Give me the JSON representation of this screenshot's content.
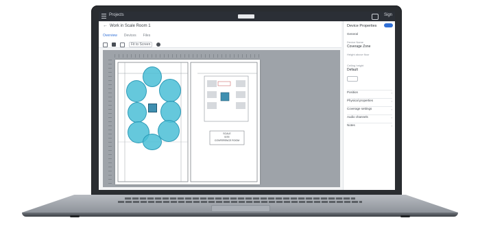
{
  "app": {
    "title": "Projects",
    "account_label": "Sign",
    "breadcrumb": "Work in Scale Room 1"
  },
  "tabs": [
    "Overview",
    "Devices",
    "Files"
  ],
  "toolbar": {
    "fit_label": "Fit to Screen"
  },
  "floorplan": {
    "stamp_lines": [
      "SCALE",
      "SITE",
      "CONFERENCE ROOM"
    ]
  },
  "properties_panel": {
    "title": "Device Properties",
    "section": "General",
    "name_label": "Device Name",
    "name_value": "Coverage Zone",
    "field2_label": "Height above floor",
    "field3_label": "Ceiling height",
    "field3_value": "Default",
    "rows": [
      "Position",
      "Physical properties",
      "Coverage settings",
      "Audio channels",
      "Notes"
    ]
  },
  "colors": {
    "coverage": "#4ABED6",
    "accent": "#2F6FD6",
    "topbar": "#2B2F36"
  }
}
